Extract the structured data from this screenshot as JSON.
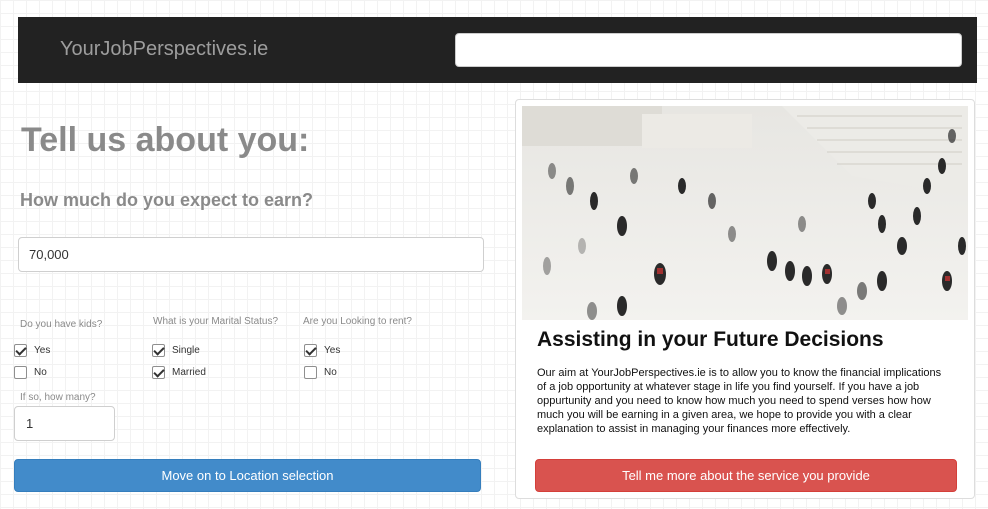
{
  "header": {
    "brand": "YourJobPerspectives.ie",
    "search_value": ""
  },
  "form": {
    "title": "Tell us about you:",
    "earn_question": "How much do you expect to earn?",
    "earn_value": "70,000",
    "kids": {
      "question": "Do you have kids?",
      "options": [
        {
          "label": "Yes",
          "checked": true
        },
        {
          "label": "No",
          "checked": false
        }
      ],
      "how_many_label": "If so, how many?",
      "how_many_value": "1"
    },
    "marital": {
      "question": "What is your Marital Status?",
      "options": [
        {
          "label": "Single",
          "checked": true
        },
        {
          "label": "Married",
          "checked": true
        }
      ]
    },
    "rent": {
      "question": "Are you Looking to rent?",
      "options": [
        {
          "label": "Yes",
          "checked": true
        },
        {
          "label": "No",
          "checked": false
        }
      ]
    },
    "next_button": "Move on to Location selection"
  },
  "info_panel": {
    "title": "Assisting in your Future Decisions",
    "text": "Our aim at YourJobPerspectives.ie is to allow you to know the financial implications of a job opportunity at whatever stage in life you find yourself. If you have a job oppurtunity and you need to know how much you need to spend verses how how much you will be earning in a given area, we hope to provide you with a clear explanation to assist in managing your finances more effectively.",
    "button": "Tell me more about the service you provide"
  },
  "colors": {
    "navbar": "#222222",
    "primary_button": "#428bca",
    "danger_button": "#d9534f"
  }
}
